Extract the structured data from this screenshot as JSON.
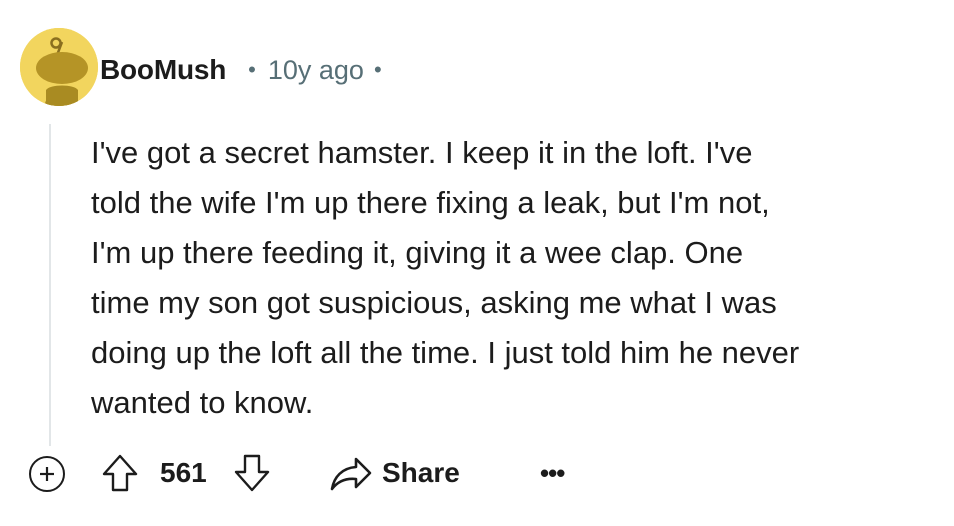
{
  "comment": {
    "author": "BooMush",
    "separator": "•",
    "age": "10y ago",
    "body": [
      "I've got a secret hamster. I keep it in the loft. I've",
      "told the wife I'm up there fixing a leak, but I'm not,",
      "I'm up there feeding it, giving it a wee clap. One",
      "time my son got suspicious, asking me what I was",
      "doing up the loft all the time. I just told him he never",
      "wanted to know."
    ]
  },
  "actions": {
    "score": "561",
    "share_label": "Share",
    "more_label": "•••"
  },
  "icons": {
    "avatar": "snoo-avatar-icon",
    "expand": "plus-circle-icon",
    "upvote": "arrow-up-icon",
    "downvote": "arrow-down-icon",
    "share": "share-arrow-icon",
    "more": "ellipsis-icon"
  },
  "colors": {
    "avatar_background": "#f2d55e",
    "meta_text": "#576f76",
    "thread_line": "#e2e6e8"
  }
}
